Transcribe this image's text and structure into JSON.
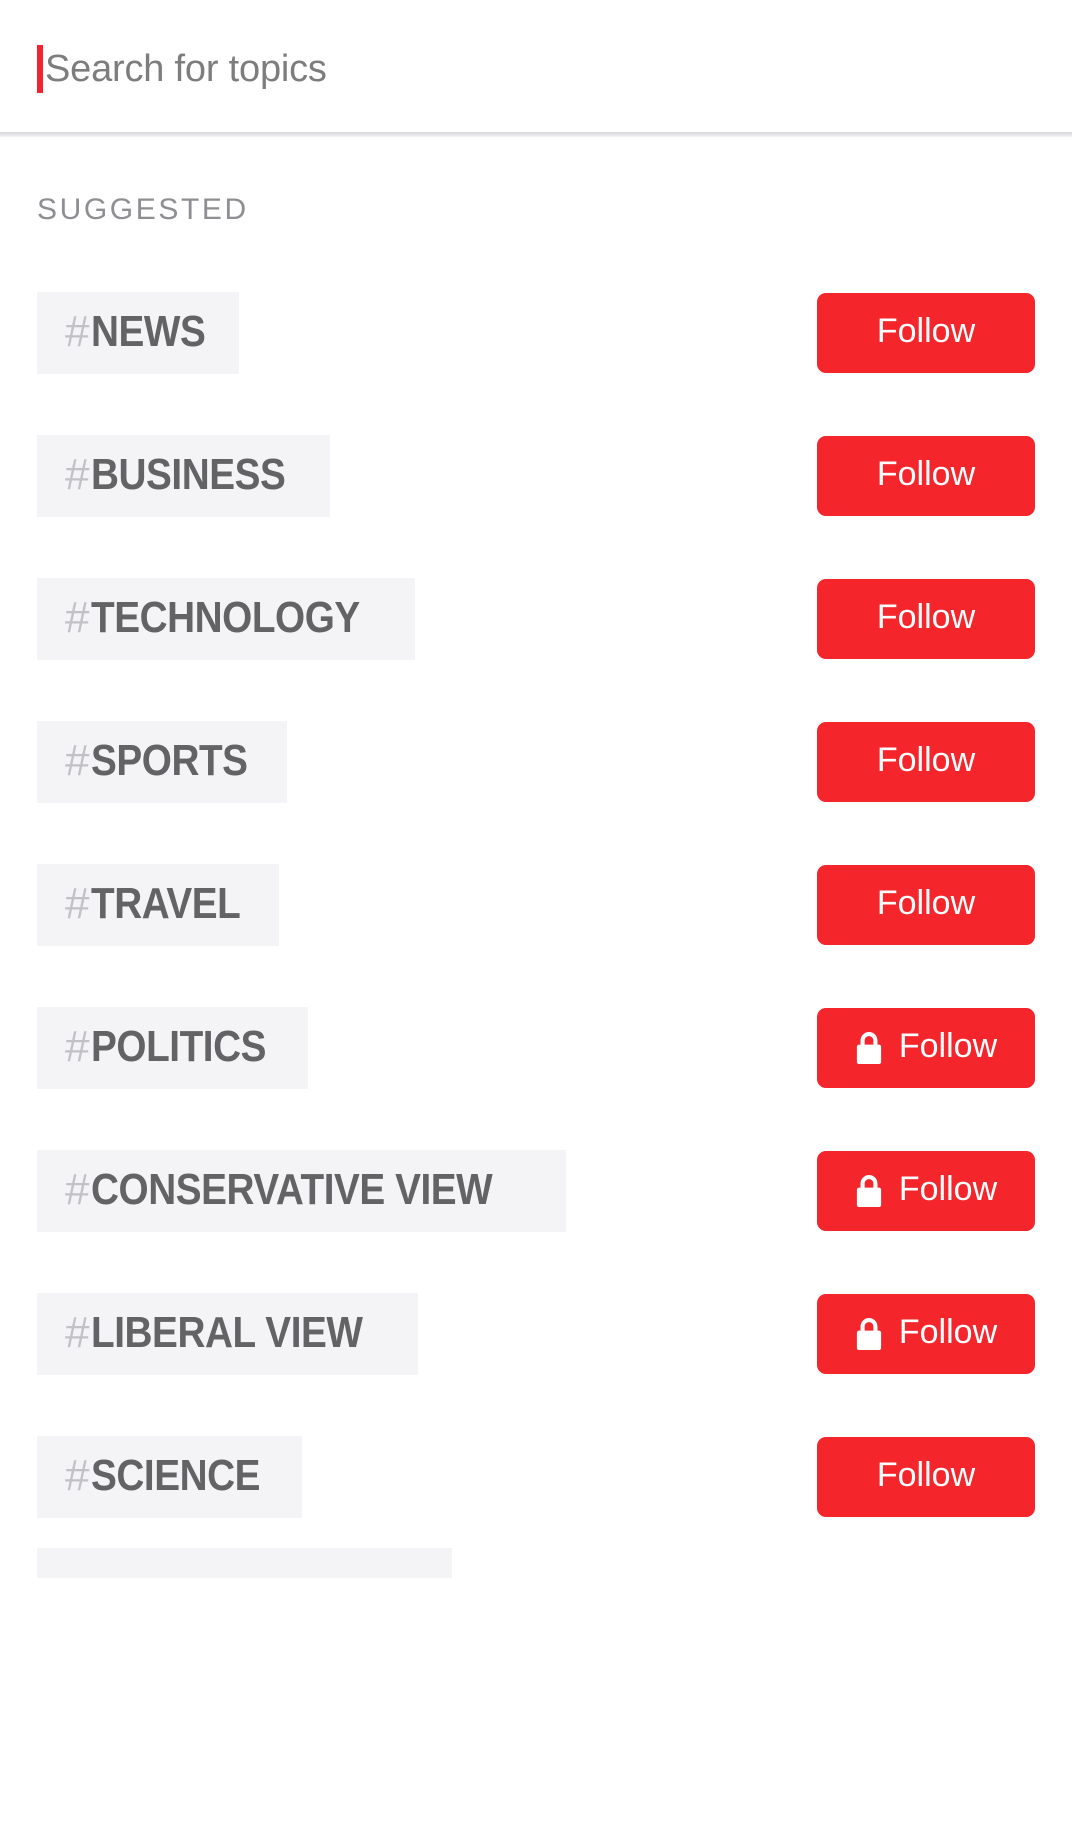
{
  "search": {
    "placeholder": "Search for topics",
    "value": "",
    "caret_color": "#F4212E"
  },
  "section": {
    "title": "SUGGESTED"
  },
  "theme": {
    "follow_button_color": "#F4252B",
    "follow_button_text_color": "#FFFFFF",
    "tag_background": "#F4F4F7",
    "hash_color": "#C2C2C6",
    "topic_text_color": "#636366",
    "section_title_color": "#8E8E93",
    "placeholder_color": "#7D7D7D"
  },
  "topics": [
    {
      "hash": "#",
      "name": "NEWS",
      "follow_label": "Follow",
      "locked": false,
      "lock_icon": "lock-icon"
    },
    {
      "hash": "#",
      "name": "BUSINESS",
      "follow_label": "Follow",
      "locked": false,
      "lock_icon": "lock-icon"
    },
    {
      "hash": "#",
      "name": "TECHNOLOGY",
      "follow_label": "Follow",
      "locked": false,
      "lock_icon": "lock-icon"
    },
    {
      "hash": "#",
      "name": "SPORTS",
      "follow_label": "Follow",
      "locked": false,
      "lock_icon": "lock-icon"
    },
    {
      "hash": "#",
      "name": "TRAVEL",
      "follow_label": "Follow",
      "locked": false,
      "lock_icon": "lock-icon"
    },
    {
      "hash": "#",
      "name": "POLITICS",
      "follow_label": "Follow",
      "locked": true,
      "lock_icon": "lock-icon"
    },
    {
      "hash": "#",
      "name": "CONSERVATIVE VIEW",
      "follow_label": "Follow",
      "locked": true,
      "lock_icon": "lock-icon"
    },
    {
      "hash": "#",
      "name": "LIBERAL VIEW",
      "follow_label": "Follow",
      "locked": true,
      "lock_icon": "lock-icon"
    },
    {
      "hash": "#",
      "name": "SCIENCE",
      "follow_label": "Follow",
      "locked": false,
      "lock_icon": "lock-icon"
    }
  ]
}
